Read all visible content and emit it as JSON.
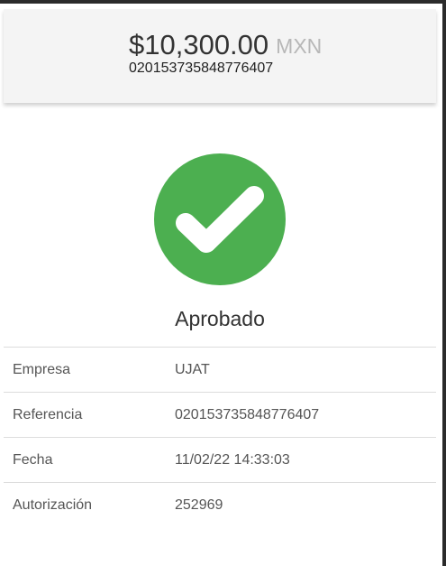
{
  "summary": {
    "amount": "$10,300.00",
    "currency": "MXN",
    "reference": "020153735848776407"
  },
  "status": {
    "label": "Aprobado",
    "icon": "check-circle-icon",
    "color": "#4caf50"
  },
  "details": [
    {
      "label": "Empresa",
      "value": "UJAT"
    },
    {
      "label": "Referencia",
      "value": "020153735848776407"
    },
    {
      "label": "Fecha",
      "value": "11/02/22 14:33:03"
    },
    {
      "label": "Autorización",
      "value": "252969"
    }
  ]
}
